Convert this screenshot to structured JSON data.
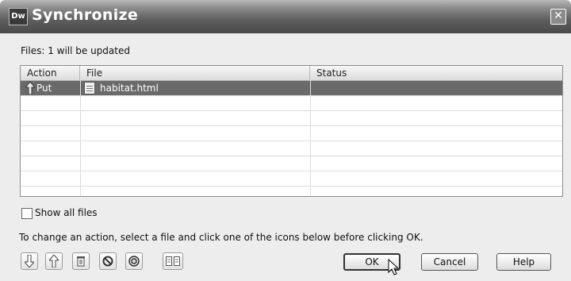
{
  "window": {
    "app_icon": "Dw",
    "title": "Synchronize",
    "close_symbol": "✕"
  },
  "files_summary": "Files: 1 will be updated",
  "table": {
    "columns": [
      "Action",
      "File",
      "Status"
    ],
    "rows": [
      {
        "action": "Put",
        "file": "habitat.html",
        "status": "",
        "selected": true
      }
    ]
  },
  "show_all_files": {
    "label": "Show all files",
    "checked": false
  },
  "hint": "To change an action, select a file and click one of the icons below before clicking OK.",
  "action_icons": [
    "get-arrow-icon",
    "put-arrow-icon",
    "delete-icon",
    "ignore-icon",
    "synchronized-icon",
    "compare-icon"
  ],
  "buttons": {
    "ok": "OK",
    "cancel": "Cancel",
    "help": "Help"
  }
}
